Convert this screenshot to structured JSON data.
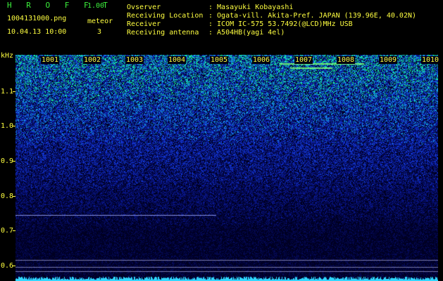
{
  "header": {
    "brand": "H R O F F T",
    "version": "1.00",
    "filename": "1004131000.png",
    "datetime": "10.04.13 10:00",
    "meteor_label": "meteor",
    "meteor_count": "3",
    "fields": [
      {
        "label": "Ovserver",
        "value": ": Masayuki Kobayashi"
      },
      {
        "label": "Receiving Location",
        "value": ": Ogata-vill. Akita-Pref. JAPAN (139.96E, 40.02N)"
      },
      {
        "label": "Receiver",
        "value": ": ICOM IC-575 53.7492(@LCD)MHz USB"
      },
      {
        "label": "Receiving antenna",
        "value": ": A504HB(yagi 4el)"
      }
    ]
  },
  "axes": {
    "y_unit": "kHz",
    "y_ticks": [
      "1.1",
      "1.0",
      "0.9",
      "0.8",
      "0.7",
      "0.6"
    ],
    "x_ticks": [
      "1001",
      "1002",
      "1003",
      "1004",
      "1005",
      "1006",
      "1007",
      "1008",
      "1009",
      "1010"
    ]
  },
  "colors": {
    "text": "#ffff40",
    "brand": "#3cf03c",
    "background": "#000000",
    "signal_low": "#000030",
    "signal_high": "#00ffa0"
  }
}
